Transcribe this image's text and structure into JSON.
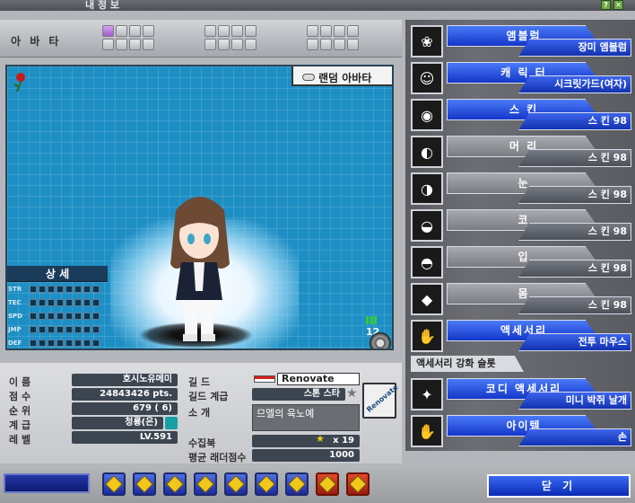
{
  "window": {
    "title": "내 정 보"
  },
  "avatar_bar": {
    "label": "아 바 타"
  },
  "preview": {
    "random_button": "랜덤 아바타",
    "signal_value": "12"
  },
  "stats": {
    "title": "상 세",
    "rows": [
      {
        "label": "STR"
      },
      {
        "label": "TEC"
      },
      {
        "label": "SPD"
      },
      {
        "label": "JMP"
      },
      {
        "label": "DEF"
      }
    ]
  },
  "info": {
    "name_label": "이 름",
    "name": "호시노유메미",
    "score_label": "점 수",
    "score": "24843426 pts.",
    "rank_label": "순 위",
    "rank": "679 ( 6)",
    "grade_label": "계 급",
    "grade": "청룡(은)",
    "level_label": "레 벨",
    "level": "LV.591",
    "guild_label": "길 드",
    "guild": "Renovate",
    "guild_rank_label": "길드 계급",
    "guild_rank": "스톤 스타",
    "intro_label": "소 개",
    "intro": "므엘의 육노예",
    "collection_label": "수집북",
    "collection": "x 19",
    "ladder_label": "평균 래더점수",
    "ladder": "1000",
    "emblem_text": "Renovate"
  },
  "slots": [
    {
      "name": "앰블럼",
      "value": "장미 앰블럼",
      "icon": "rose-icon",
      "active": true
    },
    {
      "name": "캐 릭 터",
      "value": "시크릿가드(여자)",
      "icon": "character-icon",
      "active": true
    },
    {
      "name": "스    킨",
      "value": "스   킨 98",
      "icon": "skin-icon",
      "active": true
    },
    {
      "name": "머    리",
      "value": "스   킨 98",
      "icon": "hair-icon",
      "active": false
    },
    {
      "name": "눈",
      "value": "스   킨 98",
      "icon": "eye-icon",
      "active": false
    },
    {
      "name": "코",
      "value": "스   킨 98",
      "icon": "nose-icon",
      "active": false
    },
    {
      "name": "입",
      "value": "스   킨 98",
      "icon": "mouth-icon",
      "active": false
    },
    {
      "name": "몸",
      "value": "스   킨 98",
      "icon": "body-icon",
      "active": false
    },
    {
      "name": "액세서리",
      "value": "전투 마우스",
      "icon": "accessory-icon",
      "active": true
    },
    {
      "name": "코디 액세서리",
      "value": "미니 박쥐 날개",
      "icon": "codi-accessory-icon",
      "active": true
    },
    {
      "name": "아이템",
      "value": "손",
      "icon": "hand-icon",
      "active": true
    }
  ],
  "accessory_slot_label": "액세서리 강화 슬롯",
  "close_button": "닫 기",
  "colors": {
    "accent": "#1436c8",
    "grid_bg": "#1e8fc4"
  }
}
